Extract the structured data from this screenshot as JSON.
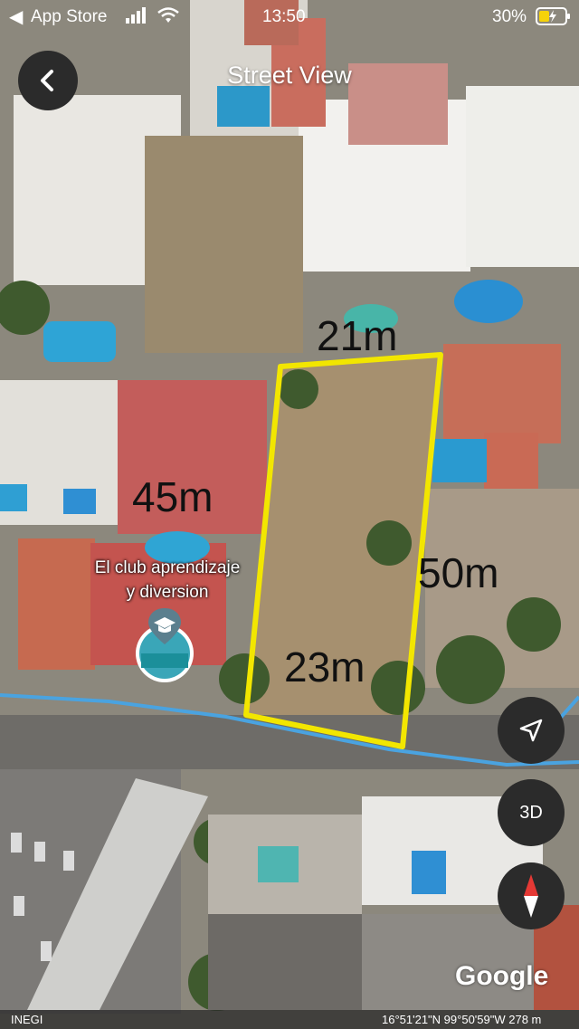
{
  "status_bar": {
    "back_app": "App Store",
    "time": "13:50",
    "battery": "30%"
  },
  "header": {
    "title": "Street View"
  },
  "measurements": {
    "top": "21m",
    "left": "45m",
    "right": "50m",
    "bottom": "23m"
  },
  "poi": {
    "name_line1": "El club aprendizaje",
    "name_line2": "y diversion",
    "icon": "graduation-cap-icon"
  },
  "controls": {
    "three_d": "3D",
    "location_icon": "navigation-arrow-icon",
    "compass_icon": "compass-icon"
  },
  "footer": {
    "attribution": "INEGI",
    "coordinates": "16°51'21\"N 99°50'59\"W 278 m",
    "watermark": "Google"
  },
  "colors": {
    "plot_outline": "#f2e600",
    "road": "#4aa3e0"
  }
}
